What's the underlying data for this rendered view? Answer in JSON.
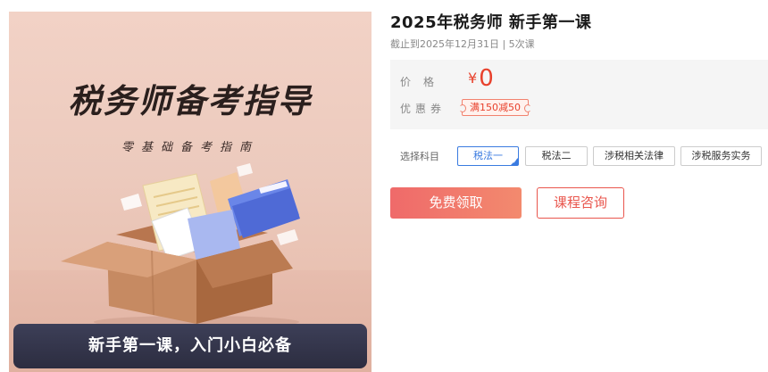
{
  "cover": {
    "title": "税务师备考指导",
    "subtitle": "零基础备考指南",
    "banner": "新手第一课，入门小白必备"
  },
  "course": {
    "title": "2025年税务师 新手第一课",
    "meta": "截止到2025年12月31日 | 5次课"
  },
  "price": {
    "label": "价格",
    "currency": "¥",
    "value": "0",
    "coupon_label": "优惠券",
    "coupon": "满150减50"
  },
  "subjects": {
    "label": "选择科目",
    "options": [
      "税法一",
      "税法二",
      "涉税相关法律",
      "涉税服务实务"
    ],
    "selected": "税法一"
  },
  "actions": {
    "free": "免费领取",
    "consult": "课程咨询"
  },
  "colors": {
    "accent_red": "#e8412c",
    "select_blue": "#3a7be0",
    "banner_dark": "#2c2d40"
  }
}
